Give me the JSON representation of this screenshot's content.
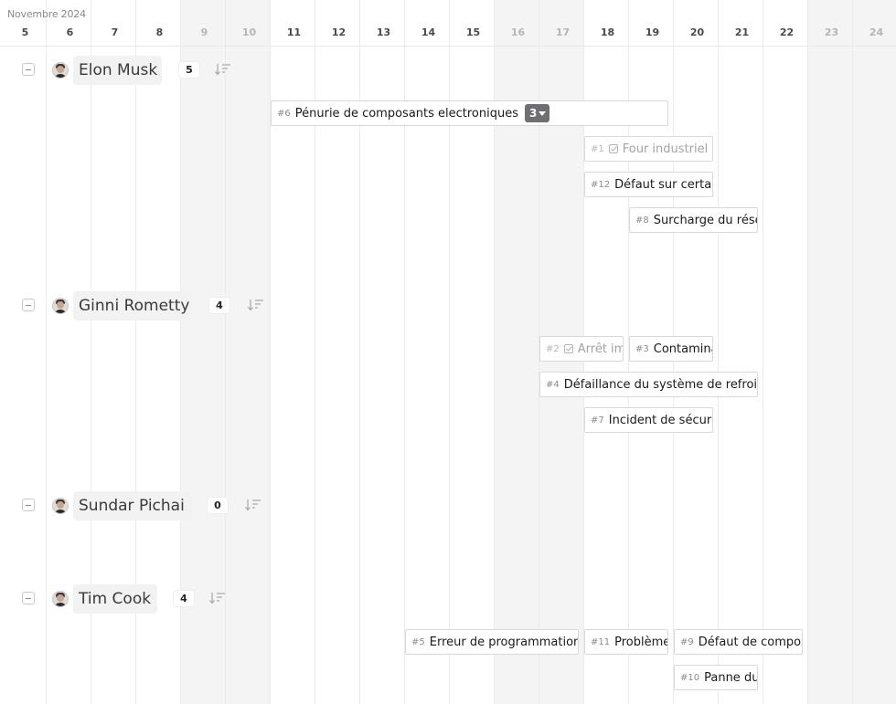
{
  "timeline": {
    "month_label": "Novembre 2024",
    "days": [
      {
        "label": "5",
        "weekend": false
      },
      {
        "label": "6",
        "weekend": false
      },
      {
        "label": "7",
        "weekend": false
      },
      {
        "label": "8",
        "weekend": false
      },
      {
        "label": "9",
        "weekend": true
      },
      {
        "label": "10",
        "weekend": true
      },
      {
        "label": "11",
        "weekend": false
      },
      {
        "label": "12",
        "weekend": false
      },
      {
        "label": "13",
        "weekend": false
      },
      {
        "label": "14",
        "weekend": false
      },
      {
        "label": "15",
        "weekend": false
      },
      {
        "label": "16",
        "weekend": true
      },
      {
        "label": "17",
        "weekend": true
      },
      {
        "label": "18",
        "weekend": false
      },
      {
        "label": "19",
        "weekend": false
      },
      {
        "label": "20",
        "weekend": false
      },
      {
        "label": "21",
        "weekend": false
      },
      {
        "label": "22",
        "weekend": false
      },
      {
        "label": "23",
        "weekend": true
      },
      {
        "label": "24",
        "weekend": true
      }
    ]
  },
  "groups": [
    {
      "name": "Elon Musk",
      "count": "5",
      "avatar_icon": "person-avatar-icon",
      "tasks": [
        {
          "id": "#6",
          "title": "Pénurie de composants electroniques",
          "done": false,
          "extra_badge": "3"
        },
        {
          "id": "#1",
          "title": "Four industriel",
          "done": true
        },
        {
          "id": "#12",
          "title": "Défaut sur certains produits",
          "done": false
        },
        {
          "id": "#8",
          "title": "Surcharge du réseau",
          "done": false
        }
      ]
    },
    {
      "name": "Ginni Rometty",
      "count": "4",
      "avatar_icon": "person-avatar-icon",
      "tasks": [
        {
          "id": "#2",
          "title": "Arrêt imprévu",
          "done": true
        },
        {
          "id": "#3",
          "title": "Contamination",
          "done": false
        },
        {
          "id": "#4",
          "title": "Défaillance du système de refroidissement",
          "done": false
        },
        {
          "id": "#7",
          "title": "Incident de sécurité",
          "done": false
        }
      ]
    },
    {
      "name": "Sundar Pichai",
      "count": "0",
      "avatar_icon": "person-avatar-icon",
      "tasks": []
    },
    {
      "name": "Tim Cook",
      "count": "4",
      "avatar_icon": "person-avatar-icon",
      "tasks": [
        {
          "id": "#5",
          "title": "Erreur de programmation",
          "done": false
        },
        {
          "id": "#11",
          "title": "Problème",
          "done": false
        },
        {
          "id": "#9",
          "title": "Défaut de composant",
          "done": false
        },
        {
          "id": "#10",
          "title": "Panne du",
          "done": false
        }
      ]
    }
  ],
  "icons": {
    "collapse": "minus-square-icon",
    "sort": "sort-descending-icon",
    "done": "check-square-icon",
    "expand_badge": "caret-down-icon"
  },
  "colors": {
    "weekend_column": "#f4f4f5",
    "grid_line": "#ececec",
    "badge_dark": "#6f6f73",
    "name_chip": "#f2f2f3"
  }
}
